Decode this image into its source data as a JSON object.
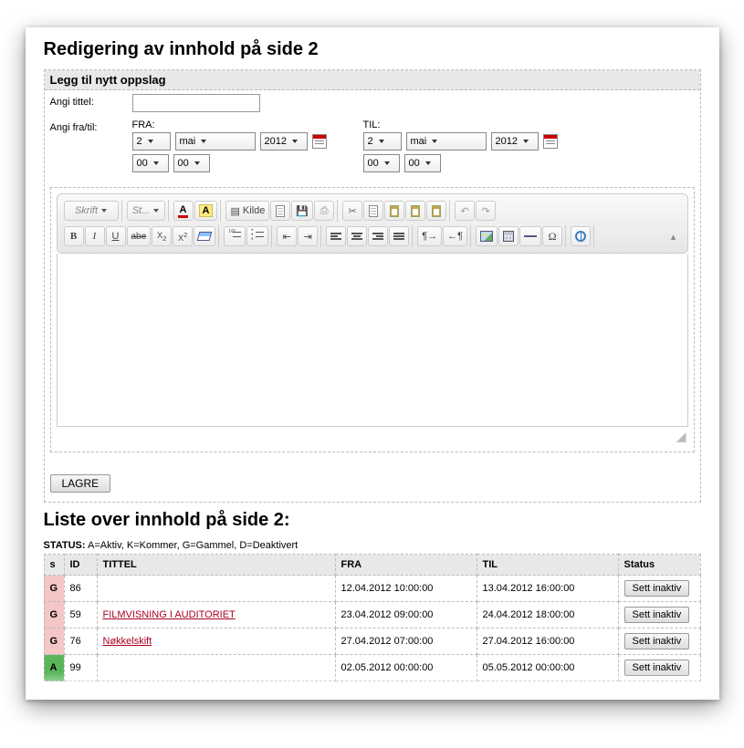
{
  "page_title": "Redigering av innhold på side 2",
  "add_section_title": "Legg til nytt oppslag",
  "label_title": "Angi tittel:",
  "label_daterange": "Angi fra/til:",
  "from_label": "FRA:",
  "to_label": "TIL:",
  "date_from": {
    "day": "2",
    "month": "mai",
    "year": "2012",
    "hh": "00",
    "mm": "00"
  },
  "date_to": {
    "day": "2",
    "month": "mai",
    "year": "2012",
    "hh": "00",
    "mm": "00"
  },
  "toolbar": {
    "font_label": "Skrift",
    "style_label": "St...",
    "source_label": "Kilde"
  },
  "save_label": "LAGRE",
  "list_heading": "Liste over innhold på side 2:",
  "status_legend_label": "STATUS:",
  "status_legend_text": "A=Aktiv, K=Kommer, G=Gammel, D=Deaktivert",
  "columns": {
    "s": "s",
    "id": "ID",
    "title": "TITTEL",
    "from": "FRA",
    "to": "TIL",
    "status": "Status"
  },
  "action_label": "Sett inaktiv",
  "rows": [
    {
      "s": "G",
      "id": "86",
      "title": "",
      "from": "12.04.2012 10:00:00",
      "to": "13.04.2012 16:00:00"
    },
    {
      "s": "G",
      "id": "59",
      "title": "FILMVISNING I AUDITORIET",
      "from": "23.04.2012 09:00:00",
      "to": "24.04.2012 18:00:00"
    },
    {
      "s": "G",
      "id": "76",
      "title": "Nøkkelskift",
      "from": "27.04.2012 07:00:00",
      "to": "27.04.2012 16:00:00"
    },
    {
      "s": "A",
      "id": "99",
      "title": "",
      "from": "02.05.2012 00:00:00",
      "to": "05.05.2012 00:00:00"
    }
  ]
}
